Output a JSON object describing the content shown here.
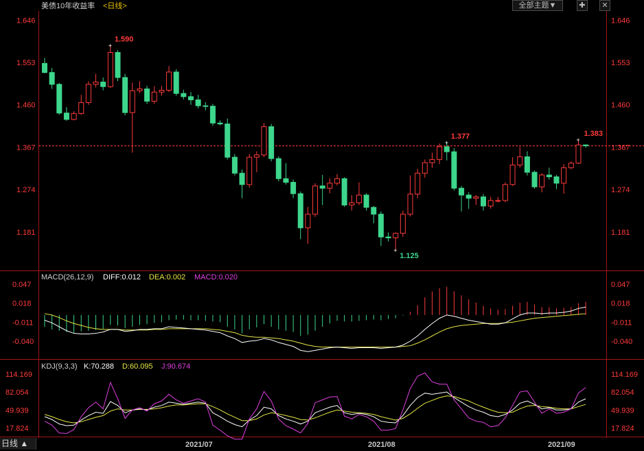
{
  "header": {
    "title": "美债10年收益率",
    "period_label": "<日线>",
    "themes_button": "全部主题▼",
    "pin_icon": "pin-icon",
    "close_icon": "close-icon"
  },
  "period_tab": "日线 ▲",
  "colors": {
    "up": "#ff3b3b",
    "down": "#3dd68c",
    "axis": "#a31515",
    "label_red": "#ff3b3b",
    "label_green": "#3dd68c",
    "diff": "#ffffff",
    "dea": "#e6e645",
    "macd_label": "#e040e0",
    "k": "#ffffff",
    "d": "#e6e645",
    "j": "#e040e0",
    "dashed": "#ff3b3b"
  },
  "price_axis": {
    "ticks": [
      "1.646",
      "1.553",
      "1.460",
      "1.367",
      "1.274",
      "1.181"
    ],
    "min": 1.11,
    "max": 1.66
  },
  "macd_axis": {
    "ticks": [
      "0.047",
      "0.018",
      "-0.011",
      "-0.040"
    ]
  },
  "kdj_axis": {
    "ticks": [
      "114.169",
      "82.054",
      "49.939",
      "17.824"
    ]
  },
  "x_labels": [
    "2021/07",
    "2021/08",
    "2021/09"
  ],
  "annotations": {
    "high1": "1.590",
    "high2": "1.377",
    "low": "1.125",
    "last": "1.383"
  },
  "macd_header": {
    "name": "MACD(26,12,9)",
    "diff": "DIFF:0.012",
    "dea": "DEA:0.002",
    "macd": "MACD:0.020"
  },
  "kdj_header": {
    "name": "KDJ(9,3,3)",
    "k": "K:70.288",
    "d": "D:60.095",
    "j": "J:90.674"
  },
  "chart_data": {
    "type": "candlestick",
    "ylim": [
      1.11,
      1.66
    ],
    "candles": [
      [
        1.551,
        1.531,
        1.563,
        1.529
      ],
      [
        1.531,
        1.505,
        1.541,
        1.495
      ],
      [
        1.505,
        1.442,
        1.508,
        1.438
      ],
      [
        1.442,
        1.428,
        1.455,
        1.425
      ],
      [
        1.428,
        1.441,
        1.446,
        1.426
      ],
      [
        1.441,
        1.465,
        1.482,
        1.438
      ],
      [
        1.465,
        1.505,
        1.512,
        1.46
      ],
      [
        1.505,
        1.51,
        1.528,
        1.498
      ],
      [
        1.51,
        1.5,
        1.52,
        1.492
      ],
      [
        1.5,
        1.575,
        1.59,
        1.497
      ],
      [
        1.575,
        1.52,
        1.58,
        1.512
      ],
      [
        1.52,
        1.443,
        1.528,
        1.437
      ],
      [
        1.443,
        1.491,
        1.509,
        1.355
      ],
      [
        1.491,
        1.495,
        1.512,
        1.486
      ],
      [
        1.495,
        1.468,
        1.502,
        1.462
      ],
      [
        1.468,
        1.488,
        1.501,
        1.462
      ],
      [
        1.488,
        1.492,
        1.502,
        1.48
      ],
      [
        1.492,
        1.532,
        1.545,
        1.488
      ],
      [
        1.532,
        1.485,
        1.538,
        1.48
      ],
      [
        1.485,
        1.478,
        1.493,
        1.472
      ],
      [
        1.478,
        1.471,
        1.488,
        1.46
      ],
      [
        1.471,
        1.458,
        1.482,
        1.452
      ],
      [
        1.458,
        1.457,
        1.466,
        1.448
      ],
      [
        1.457,
        1.42,
        1.462,
        1.414
      ],
      [
        1.42,
        1.418,
        1.426,
        1.415
      ],
      [
        1.418,
        1.345,
        1.43,
        1.34
      ],
      [
        1.345,
        1.31,
        1.352,
        1.305
      ],
      [
        1.31,
        1.285,
        1.318,
        1.255
      ],
      [
        1.285,
        1.345,
        1.352,
        1.278
      ],
      [
        1.345,
        1.35,
        1.358,
        1.312
      ],
      [
        1.35,
        1.412,
        1.42,
        1.345
      ],
      [
        1.412,
        1.342,
        1.418,
        1.336
      ],
      [
        1.342,
        1.298,
        1.347,
        1.292
      ],
      [
        1.298,
        1.29,
        1.332,
        1.285
      ],
      [
        1.29,
        1.265,
        1.296,
        1.255
      ],
      [
        1.265,
        1.19,
        1.27,
        1.165
      ],
      [
        1.19,
        1.22,
        1.236,
        1.155
      ],
      [
        1.22,
        1.282,
        1.288,
        1.214
      ],
      [
        1.282,
        1.277,
        1.306,
        1.24
      ],
      [
        1.277,
        1.288,
        1.299,
        1.266
      ],
      [
        1.288,
        1.298,
        1.308,
        1.283
      ],
      [
        1.298,
        1.24,
        1.301,
        1.236
      ],
      [
        1.24,
        1.245,
        1.262,
        1.228
      ],
      [
        1.245,
        1.262,
        1.29,
        1.24
      ],
      [
        1.262,
        1.235,
        1.266,
        1.228
      ],
      [
        1.235,
        1.22,
        1.238,
        1.2
      ],
      [
        1.22,
        1.17,
        1.226,
        1.15
      ],
      [
        1.17,
        1.168,
        1.18,
        1.16
      ],
      [
        1.168,
        1.178,
        1.18,
        1.14
      ],
      [
        1.178,
        1.22,
        1.228,
        1.17
      ],
      [
        1.22,
        1.264,
        1.305,
        1.215
      ],
      [
        1.264,
        1.31,
        1.32,
        1.255
      ],
      [
        1.31,
        1.333,
        1.34,
        1.3
      ],
      [
        1.333,
        1.34,
        1.355,
        1.322
      ],
      [
        1.34,
        1.368,
        1.375,
        1.33
      ],
      [
        1.368,
        1.357,
        1.377,
        1.338
      ],
      [
        1.357,
        1.277,
        1.365,
        1.272
      ],
      [
        1.277,
        1.262,
        1.282,
        1.226
      ],
      [
        1.262,
        1.255,
        1.268,
        1.232
      ],
      [
        1.255,
        1.258,
        1.262,
        1.24
      ],
      [
        1.258,
        1.238,
        1.264,
        1.228
      ],
      [
        1.238,
        1.25,
        1.258,
        1.232
      ],
      [
        1.25,
        1.25,
        1.258,
        1.246
      ],
      [
        1.25,
        1.285,
        1.29,
        1.246
      ],
      [
        1.285,
        1.328,
        1.345,
        1.282
      ],
      [
        1.328,
        1.346,
        1.368,
        1.322
      ],
      [
        1.346,
        1.312,
        1.358,
        1.305
      ],
      [
        1.312,
        1.28,
        1.316,
        1.276
      ],
      [
        1.28,
        1.306,
        1.31,
        1.268
      ],
      [
        1.306,
        1.302,
        1.322,
        1.296
      ],
      [
        1.302,
        1.288,
        1.306,
        1.275
      ],
      [
        1.288,
        1.322,
        1.33,
        1.265
      ],
      [
        1.322,
        1.332,
        1.336,
        1.319
      ],
      [
        1.332,
        1.372,
        1.383,
        1.33
      ],
      [
        1.372,
        1.37,
        1.373,
        1.366
      ]
    ],
    "macd_hist": [
      -0.018,
      -0.022,
      -0.024,
      -0.026,
      -0.027,
      -0.025,
      -0.024,
      -0.023,
      -0.021,
      -0.015,
      -0.016,
      -0.02,
      -0.018,
      -0.015,
      -0.014,
      -0.012,
      -0.011,
      -0.008,
      -0.007,
      -0.007,
      -0.008,
      -0.008,
      -0.009,
      -0.01,
      -0.011,
      -0.018,
      -0.022,
      -0.028,
      -0.022,
      -0.019,
      -0.014,
      -0.018,
      -0.022,
      -0.024,
      -0.026,
      -0.032,
      -0.03,
      -0.024,
      -0.018,
      -0.013,
      -0.009,
      -0.01,
      -0.01,
      -0.009,
      -0.008,
      -0.007,
      -0.008,
      -0.006,
      -0.005,
      -0.001,
      0.005,
      0.015,
      0.027,
      0.036,
      0.041,
      0.043,
      0.036,
      0.03,
      0.024,
      0.019,
      0.014,
      0.01,
      0.008,
      0.009,
      0.014,
      0.019,
      0.02,
      0.016,
      0.012,
      0.012,
      0.01,
      0.011,
      0.012,
      0.018,
      0.02
    ],
    "macd_diff": [
      -0.008,
      -0.012,
      -0.018,
      -0.024,
      -0.028,
      -0.029,
      -0.029,
      -0.028,
      -0.026,
      -0.022,
      -0.022,
      -0.025,
      -0.024,
      -0.022,
      -0.022,
      -0.021,
      -0.021,
      -0.018,
      -0.019,
      -0.02,
      -0.021,
      -0.022,
      -0.023,
      -0.025,
      -0.027,
      -0.032,
      -0.036,
      -0.042,
      -0.04,
      -0.039,
      -0.036,
      -0.038,
      -0.042,
      -0.045,
      -0.048,
      -0.054,
      -0.056,
      -0.054,
      -0.052,
      -0.05,
      -0.049,
      -0.05,
      -0.051,
      -0.05,
      -0.05,
      -0.05,
      -0.051,
      -0.05,
      -0.049,
      -0.046,
      -0.04,
      -0.032,
      -0.022,
      -0.013,
      -0.005,
      0.0,
      -0.002,
      -0.005,
      -0.008,
      -0.01,
      -0.012,
      -0.014,
      -0.014,
      -0.012,
      -0.006,
      0.0,
      0.003,
      0.003,
      0.002,
      0.003,
      0.003,
      0.004,
      0.006,
      0.01,
      0.012
    ],
    "macd_dea": [
      0.002,
      0.0,
      -0.004,
      -0.009,
      -0.013,
      -0.016,
      -0.019,
      -0.021,
      -0.022,
      -0.022,
      -0.022,
      -0.023,
      -0.023,
      -0.023,
      -0.023,
      -0.022,
      -0.022,
      -0.021,
      -0.021,
      -0.021,
      -0.021,
      -0.021,
      -0.021,
      -0.022,
      -0.023,
      -0.025,
      -0.027,
      -0.031,
      -0.033,
      -0.034,
      -0.034,
      -0.035,
      -0.036,
      -0.038,
      -0.04,
      -0.043,
      -0.046,
      -0.048,
      -0.049,
      -0.049,
      -0.049,
      -0.049,
      -0.049,
      -0.049,
      -0.049,
      -0.049,
      -0.049,
      -0.049,
      -0.049,
      -0.048,
      -0.047,
      -0.043,
      -0.038,
      -0.032,
      -0.026,
      -0.021,
      -0.018,
      -0.016,
      -0.015,
      -0.014,
      -0.013,
      -0.013,
      -0.013,
      -0.012,
      -0.011,
      -0.009,
      -0.007,
      -0.005,
      -0.004,
      -0.003,
      -0.002,
      -0.001,
      0.0,
      0.001,
      0.002
    ],
    "kdj_k": [
      38,
      33,
      25,
      22,
      23,
      32,
      40,
      46,
      44,
      65,
      58,
      45,
      50,
      52,
      50,
      55,
      58,
      64,
      62,
      60,
      62,
      64,
      62,
      45,
      38,
      30,
      24,
      20,
      32,
      40,
      55,
      52,
      40,
      34,
      30,
      25,
      30,
      45,
      50,
      55,
      58,
      45,
      42,
      44,
      42,
      38,
      30,
      28,
      27,
      40,
      58,
      72,
      80,
      78,
      80,
      82,
      72,
      64,
      56,
      50,
      46,
      40,
      38,
      42,
      50,
      62,
      66,
      60,
      52,
      54,
      50,
      50,
      52,
      64,
      70
    ],
    "kdj_d": [
      42,
      38,
      33,
      29,
      27,
      29,
      33,
      37,
      40,
      48,
      52,
      50,
      50,
      51,
      51,
      52,
      54,
      57,
      59,
      59,
      60,
      61,
      61,
      56,
      50,
      43,
      37,
      31,
      31,
      34,
      41,
      45,
      43,
      40,
      37,
      33,
      32,
      36,
      41,
      46,
      50,
      48,
      46,
      45,
      44,
      42,
      38,
      35,
      32,
      35,
      43,
      53,
      62,
      67,
      72,
      75,
      74,
      70,
      66,
      60,
      55,
      50,
      46,
      45,
      46,
      52,
      57,
      58,
      56,
      55,
      53,
      52,
      52,
      56,
      60
    ],
    "kdj_j": [
      30,
      23,
      9,
      8,
      15,
      38,
      54,
      64,
      52,
      99,
      70,
      35,
      50,
      54,
      48,
      61,
      66,
      78,
      68,
      62,
      66,
      70,
      64,
      23,
      14,
      4,
      -2,
      -2,
      34,
      52,
      83,
      66,
      34,
      22,
      16,
      9,
      26,
      63,
      68,
      73,
      74,
      39,
      34,
      42,
      38,
      30,
      14,
      14,
      17,
      50,
      88,
      110,
      116,
      100,
      96,
      96,
      68,
      52,
      36,
      30,
      28,
      20,
      22,
      36,
      58,
      82,
      84,
      64,
      44,
      52,
      44,
      46,
      52,
      80,
      90
    ],
    "kdj_ylim": [
      5,
      120
    ]
  }
}
